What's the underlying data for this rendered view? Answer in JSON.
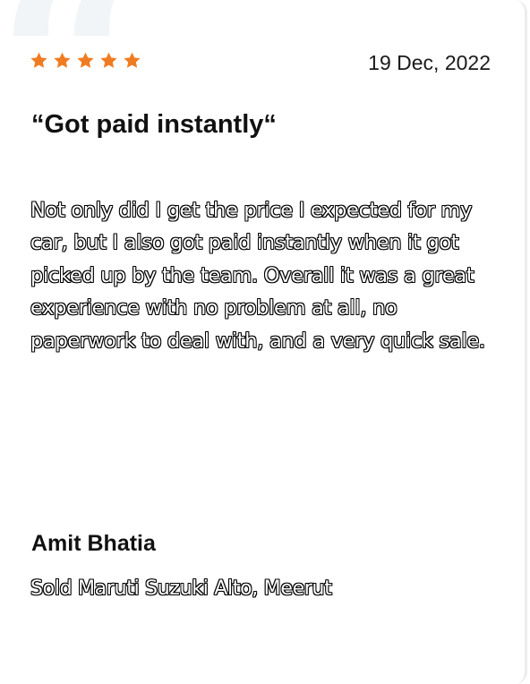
{
  "colors": {
    "star": "#f07c22",
    "quote_mark": "#f2f5f7",
    "text": "#111111",
    "card_border": "#ececec"
  },
  "icons": {
    "quote": "quote-mark-icon",
    "star": "star-icon"
  },
  "review": {
    "rating": 5,
    "rating_max": 5,
    "date": "19 Dec, 2022",
    "headline": "“Got paid instantly“",
    "body": "Not only did I get the price I expected for my car, but I also got paid instantly when it got picked up by the team. Overall it was a great experience with no problem at all, no paperwork to deal with, and a very quick sale.",
    "author": "Amit Bhatia",
    "sold_info": "Sold Maruti Suzuki Alto, Meerut"
  }
}
